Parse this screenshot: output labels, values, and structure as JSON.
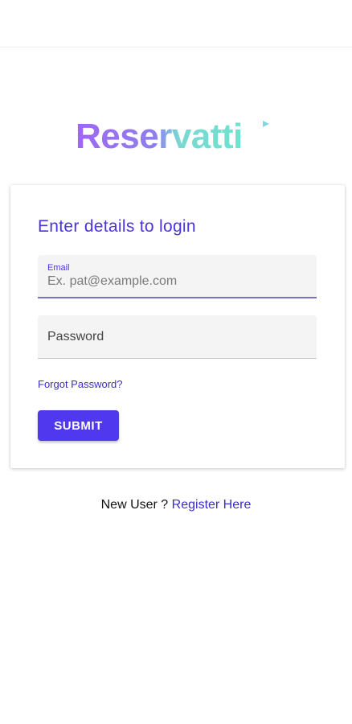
{
  "brand": {
    "logo_part1": "Reser",
    "logo_part2": "vatti",
    "color_purple": "#9b6bf0",
    "color_teal": "#72e0d0"
  },
  "login_card": {
    "title": "Enter details to login",
    "email_label": "Email",
    "email_placeholder": "Ex. pat@example.com",
    "password_label": "Password",
    "forgot_password": "Forgot Password?",
    "submit_label": "SUBMIT"
  },
  "footer": {
    "new_user_text": "New User ?",
    "register_link": "Register Here"
  },
  "colors": {
    "accent": "#4f38ee",
    "link": "#3a2cc8",
    "field_background": "#f4f4f4"
  }
}
